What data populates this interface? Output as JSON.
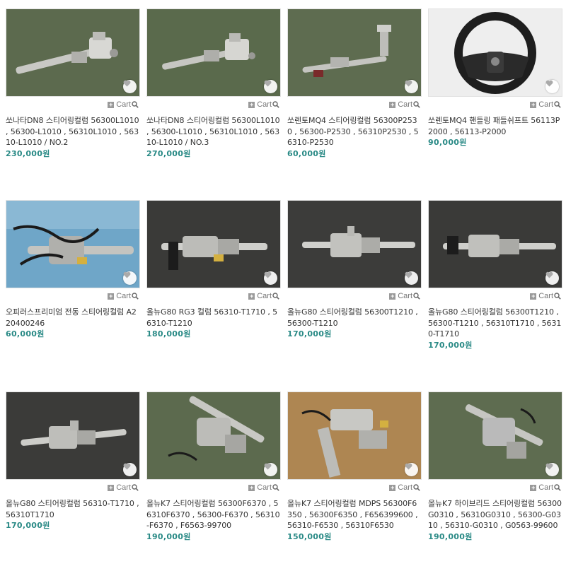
{
  "cart_label": "Cart",
  "colors": {
    "price": "#2a8a86",
    "text": "#333333",
    "cart": "#777777"
  },
  "products": [
    {
      "title": "쏘나타DN8 스티어링컬럼 56300L1010 , 56300-L1010 , 56310L1010 , 56310-L1010 / NO.2",
      "price": "230,000원",
      "photo": "steering-column",
      "bg": "#5c6a4e"
    },
    {
      "title": "쏘나타DN8 스티어링컬럼 56300L1010 , 56300-L1010 , 56310L1010 , 56310-L1010 / NO.3",
      "price": "270,000원",
      "photo": "steering-column",
      "bg": "#5a6a4c"
    },
    {
      "title": "쏘렌토MQ4 스티어링컬럼 56300P2530 , 56300-P2530 , 56310P2530 , 56310-P2530",
      "price": "60,000원",
      "photo": "steering-column",
      "bg": "#5e6c50"
    },
    {
      "title": "쏘렌토MQ4 핸들링 패들쉬프트 56113P2000 , 56113-P2000",
      "price": "90,000원",
      "photo": "steering-wheel",
      "bg": "#eeeeee"
    },
    {
      "title": "오피러스프리미엄 전동 스티어링컬럼 A220400246",
      "price": "60,000원",
      "photo": "steering-column-harness",
      "bg": "#6fa6c8"
    },
    {
      "title": "올뉴G80 RG3 컬럼 56310-T1710 , 56310-T1210",
      "price": "180,000원",
      "photo": "steering-column",
      "bg": "#3a3a38"
    },
    {
      "title": "올뉴G80 스티어링컬럼 56300T1210 , 56300-T1210",
      "price": "170,000원",
      "photo": "steering-column",
      "bg": "#3c3c3a"
    },
    {
      "title": "올뉴G80 스티어링컬럼 56300T1210 , 56300-T1210 , 56310T1710 , 56310-T1710",
      "price": "170,000원",
      "photo": "steering-column",
      "bg": "#3a3a38"
    },
    {
      "title": "올뉴G80 스티어링컬럼 56310-T1710 , 56310T1710",
      "price": "170,000원",
      "photo": "steering-column",
      "bg": "#3b3b39"
    },
    {
      "title": "올뉴K7 스티어링컬럼 56300F6370 , 56310F6370 , 56300-F6370 , 56310-F6370 , F6563-99700",
      "price": "190,000원",
      "photo": "steering-column",
      "bg": "#5c6a4e"
    },
    {
      "title": "올뉴K7 스티어링컬럼 MDPS 56300F6350 , 56300F6350 , F656399600 , 56310-F6530 , 56310F6530",
      "price": "150,000원",
      "photo": "steering-column-mdps",
      "bg": "#b48c56"
    },
    {
      "title": "올뉴K7 하이브리드 스티어링컬럼 56300G0310 , 56310G0310 , 56300-G0310 , 56310-G0310 , G0563-99600",
      "price": "190,000원",
      "photo": "steering-column",
      "bg": "#5e6c50"
    }
  ]
}
